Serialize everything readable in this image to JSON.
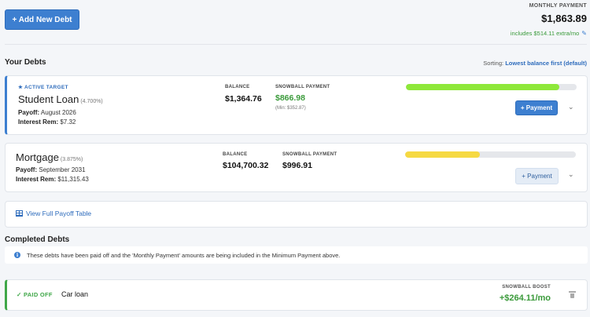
{
  "header": {
    "add_button": "+ Add New Debt",
    "monthly_label": "MONTHLY PAYMENT",
    "monthly_amount": "$1,863.89",
    "extra_note": "includes $514.11 extra/mo"
  },
  "your_debts": {
    "title": "Your Debts",
    "sorting_label": "Sorting:",
    "sorting_value": "Lowest balance first (default)"
  },
  "debts": [
    {
      "tag": "★ ACTIVE TARGET",
      "name": "Student Loan",
      "rate": "(4.700%)",
      "payoff_label": "Payoff:",
      "payoff_value": "August 2026",
      "interest_label": "Interest Rem:",
      "interest_value": "$7.32",
      "balance_label": "BALANCE",
      "balance_value": "$1,364.76",
      "snowball_label": "SNOWBALL PAYMENT",
      "snowball_value": "$866.98",
      "min_note": "(Min: $352.87)",
      "progress": 0.9,
      "progress_color": "#8ee83a",
      "button": "+ Payment"
    },
    {
      "name": "Mortgage",
      "rate": "(3.875%)",
      "payoff_label": "Payoff:",
      "payoff_value": "September 2031",
      "interest_label": "Interest Rem:",
      "interest_value": "$11,315.43",
      "balance_label": "BALANCE",
      "balance_value": "$104,700.32",
      "snowball_label": "SNOWBALL PAYMENT",
      "snowball_value": "$996.91",
      "progress": 0.44,
      "progress_color": "#f6d942",
      "button": "+ Payment"
    }
  ],
  "payoff_table_link": "View Full Payoff Table",
  "completed": {
    "title": "Completed Debts",
    "info": "These debts have been paid off and the 'Monthly Payment' amounts are being included in the Minimum Payment above.",
    "items": [
      {
        "tag": "✓ PAID OFF",
        "name": "Car loan",
        "boost_label": "SNOWBALL BOOST",
        "boost_value": "+$264.11/mo"
      }
    ]
  },
  "colors": {
    "accent": "#3d7fd0",
    "success": "#3fa748"
  },
  "icons": {
    "edit": "pencil-icon",
    "table": "table-icon",
    "info": "info-icon",
    "expand": "chevron-down-icon",
    "delete": "trash-icon"
  }
}
